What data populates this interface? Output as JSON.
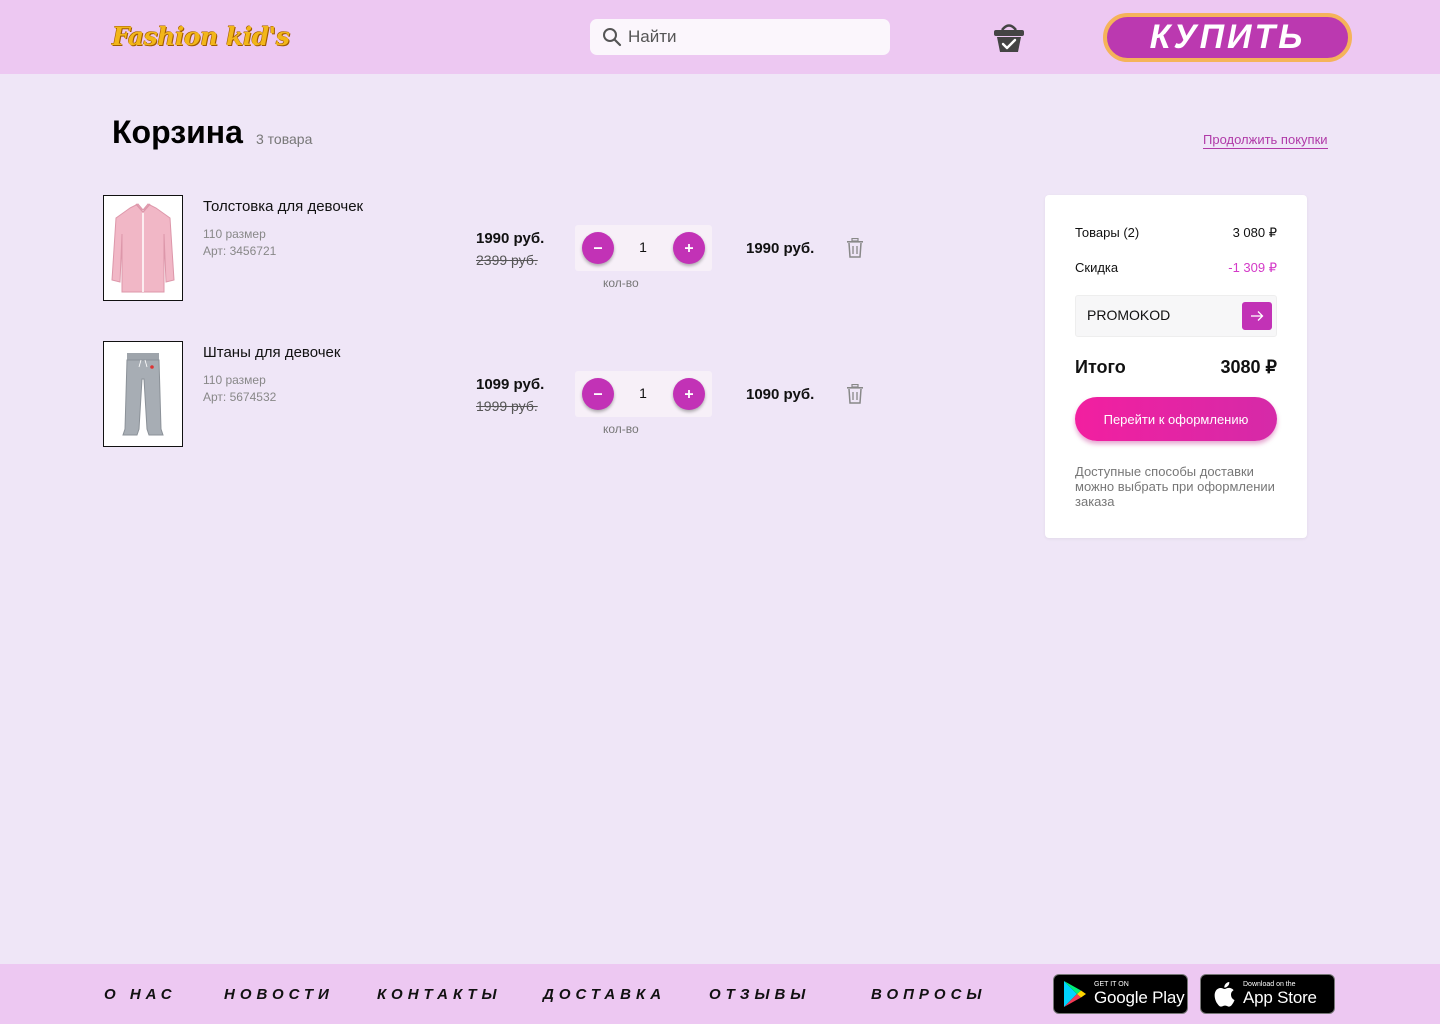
{
  "header": {
    "logo": "Fashion kid's",
    "search_placeholder": "Найти",
    "buy_label": "КУПИТЬ"
  },
  "cart": {
    "title": "Корзина",
    "count": "3 товара",
    "continue_label": "Продолжить покупки",
    "items": [
      {
        "name": "Толстовка для девочек",
        "size": "110 размер",
        "article": "Арт: 3456721",
        "price": "1990 руб.",
        "old_price": "2399 руб.",
        "qty": "1",
        "qty_label": "кол-во",
        "total": "1990 руб."
      },
      {
        "name": "Штаны для девочек",
        "size": "110 размер",
        "article": "Арт: 5674532",
        "price": "1099 руб.",
        "old_price": "1999 руб.",
        "qty": "1",
        "qty_label": "кол-во",
        "total": "1090 руб."
      }
    ]
  },
  "summary": {
    "goods_label": "Товары (2)",
    "goods_value": "3 080 ₽",
    "discount_label": "Скидка",
    "discount_value": "-1 309 ₽",
    "promo_value": "PROMOKOD",
    "total_label": "Итого",
    "total_value": "3080 ₽",
    "checkout_label": "Перейти к оформлению",
    "delivery_note": "Доступные способы доставки можно выбрать при оформлении заказа"
  },
  "footer": {
    "links": [
      "О НАС",
      "НОВОСТИ",
      "КОНТАКТЫ",
      "ДОСТАВКА",
      "ОТЗЫВЫ",
      "ВОПРОСЫ"
    ],
    "google_small": "GET IT ON",
    "google_big": "Google Play",
    "apple_small": "Download on the",
    "apple_big": "App Store"
  },
  "colors": {
    "header_bg": "#edc8f2",
    "page_bg": "#efe6f7",
    "accent": "#c232b6",
    "checkout": "#f21fa0",
    "buy_border": "#f5b35a",
    "logo": "#f2b619"
  },
  "icons": [
    "search-icon",
    "basket-icon",
    "minus-icon",
    "plus-icon",
    "trash-icon",
    "arrow-right-icon",
    "google-play-icon",
    "apple-icon"
  ]
}
